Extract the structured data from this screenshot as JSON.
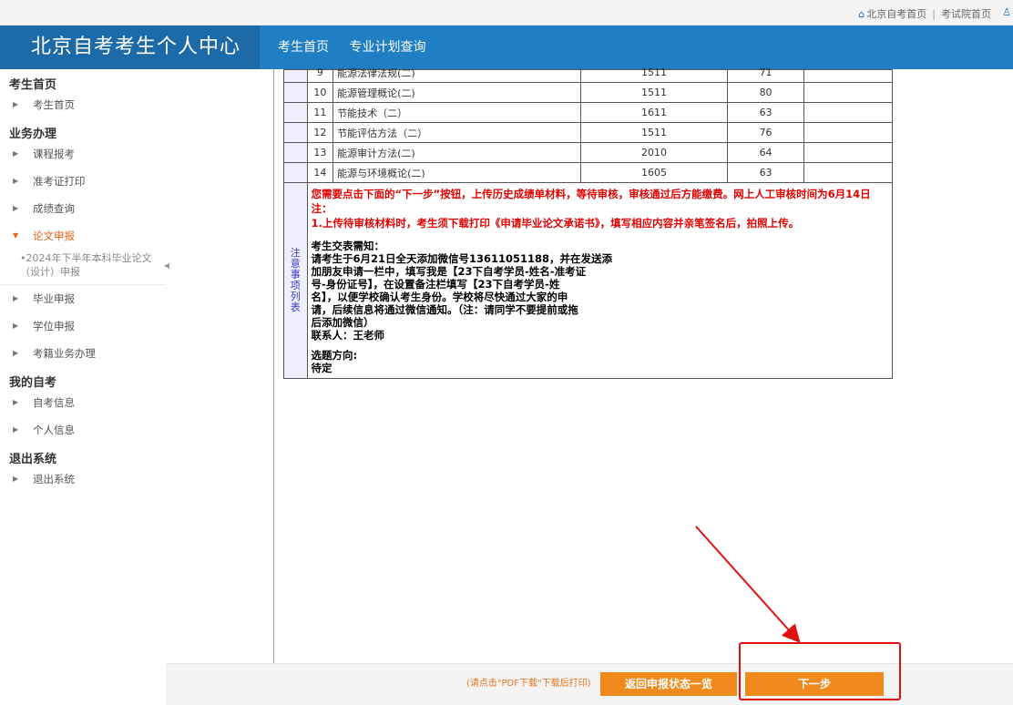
{
  "topbar": {
    "home_link": "北京自考首页",
    "separator": "|",
    "exam_link": "考试院首页"
  },
  "header": {
    "title": "北京自考考生个人中心",
    "nav": [
      "考生首页",
      "专业计划查询"
    ]
  },
  "sidebar": {
    "sections": [
      {
        "title": "考生首页",
        "items": [
          {
            "label": "考生首页"
          }
        ]
      },
      {
        "title": "业务办理",
        "items": [
          {
            "label": "课程报考"
          },
          {
            "label": "准考证打印"
          },
          {
            "label": "成绩查询"
          },
          {
            "label": "论文申报",
            "active": true,
            "sub": "•2024年下半年本科毕业论文（设计）申报"
          },
          {
            "label": "毕业申报"
          },
          {
            "label": "学位申报"
          },
          {
            "label": "考籍业务办理"
          }
        ]
      },
      {
        "title": "我的自考",
        "items": [
          {
            "label": "自考信息"
          },
          {
            "label": "个人信息"
          }
        ]
      },
      {
        "title": "退出系统",
        "items": [
          {
            "label": "退出系统"
          }
        ]
      }
    ]
  },
  "courses": [
    {
      "no": "9",
      "name": "能源法律法规(二)",
      "code": "1511",
      "score": "71"
    },
    {
      "no": "10",
      "name": "能源管理概论(二)",
      "code": "1511",
      "score": "80"
    },
    {
      "no": "11",
      "name": "节能技术（二）",
      "code": "1611",
      "score": "63"
    },
    {
      "no": "12",
      "name": "节能评估方法（二）",
      "code": "1511",
      "score": "76"
    },
    {
      "no": "13",
      "name": "能源审计方法(二)",
      "code": "2010",
      "score": "64"
    },
    {
      "no": "14",
      "name": "能源与环境概论(二)",
      "code": "1605",
      "score": "63"
    }
  ],
  "notice": {
    "side_label": "注意事项列表",
    "line1": "您需要点击下面的“下一步”按钮，上传历史成绩单材料，等待审核，审核通过后方能缴费。网上人工审核时间为6月14日",
    "line2": "注：",
    "line3": "1.上传待审核材料时，考生须下载打印《申请毕业论文承诺书》，填写相应内容并亲笔签名后，拍照上传。",
    "heading": "考生交表需知：",
    "body": [
      "请考生于6月21日全天添加微信号13611051188，并在发送添",
      "加朋友申请一栏中，填写我是【23下自考学员-姓名-准考证",
      "号-身份证号】，在设置备注栏填写【23下自考学员-姓",
      "名】，以便学校确认考生身份。学校将尽快通过大家的申",
      "请，后续信息将通过微信通知。（注：请同学不要提前或拖",
      "后添加微信）"
    ],
    "contact": "联系人：王老师",
    "direction_heading": "选题方向:",
    "direction_value": "待定"
  },
  "footer": {
    "hint": "(请点击\"PDF下载\"下载后打印)",
    "back_button": "返回申报状态一览",
    "next_button": "下一步"
  },
  "colors": {
    "header_blue": "#1f7ec4",
    "brand_blue": "#1d6aa8",
    "button_orange": "#f08a1c",
    "alert_red": "#e00000"
  }
}
